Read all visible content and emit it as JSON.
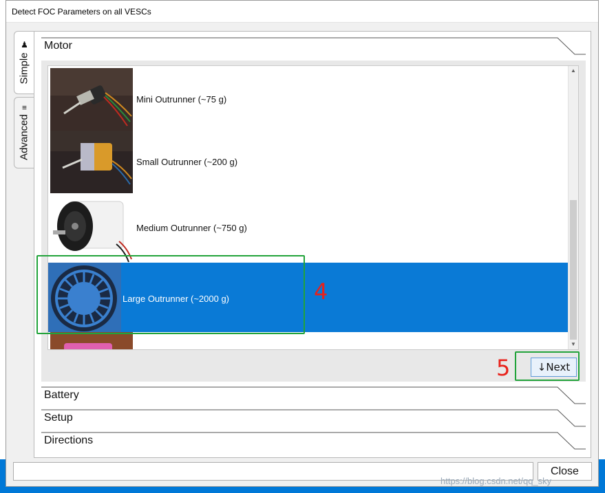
{
  "window": {
    "title": "Detect FOC Parameters on all VESCs"
  },
  "tabs": [
    {
      "label": "Simple",
      "icon": "person-icon",
      "active": true
    },
    {
      "label": "Advanced",
      "icon": "sliders-icon",
      "active": false
    }
  ],
  "sections": {
    "motor": "Motor",
    "battery": "Battery",
    "setup": "Setup",
    "directions": "Directions"
  },
  "motors": [
    {
      "label": "Mini Outrunner (~75 g)"
    },
    {
      "label": "Small Outrunner (~200 g)"
    },
    {
      "label": "Medium Outrunner (~750 g)"
    },
    {
      "label": "Large Outrunner (~2000 g)",
      "selected": true
    }
  ],
  "buttons": {
    "next": "Next",
    "next_icon": "arrow-down-icon",
    "close": "Close"
  },
  "annotations": {
    "step4": "4",
    "step5": "5"
  },
  "watermark": "https://blog.csdn.net/qq_sky"
}
